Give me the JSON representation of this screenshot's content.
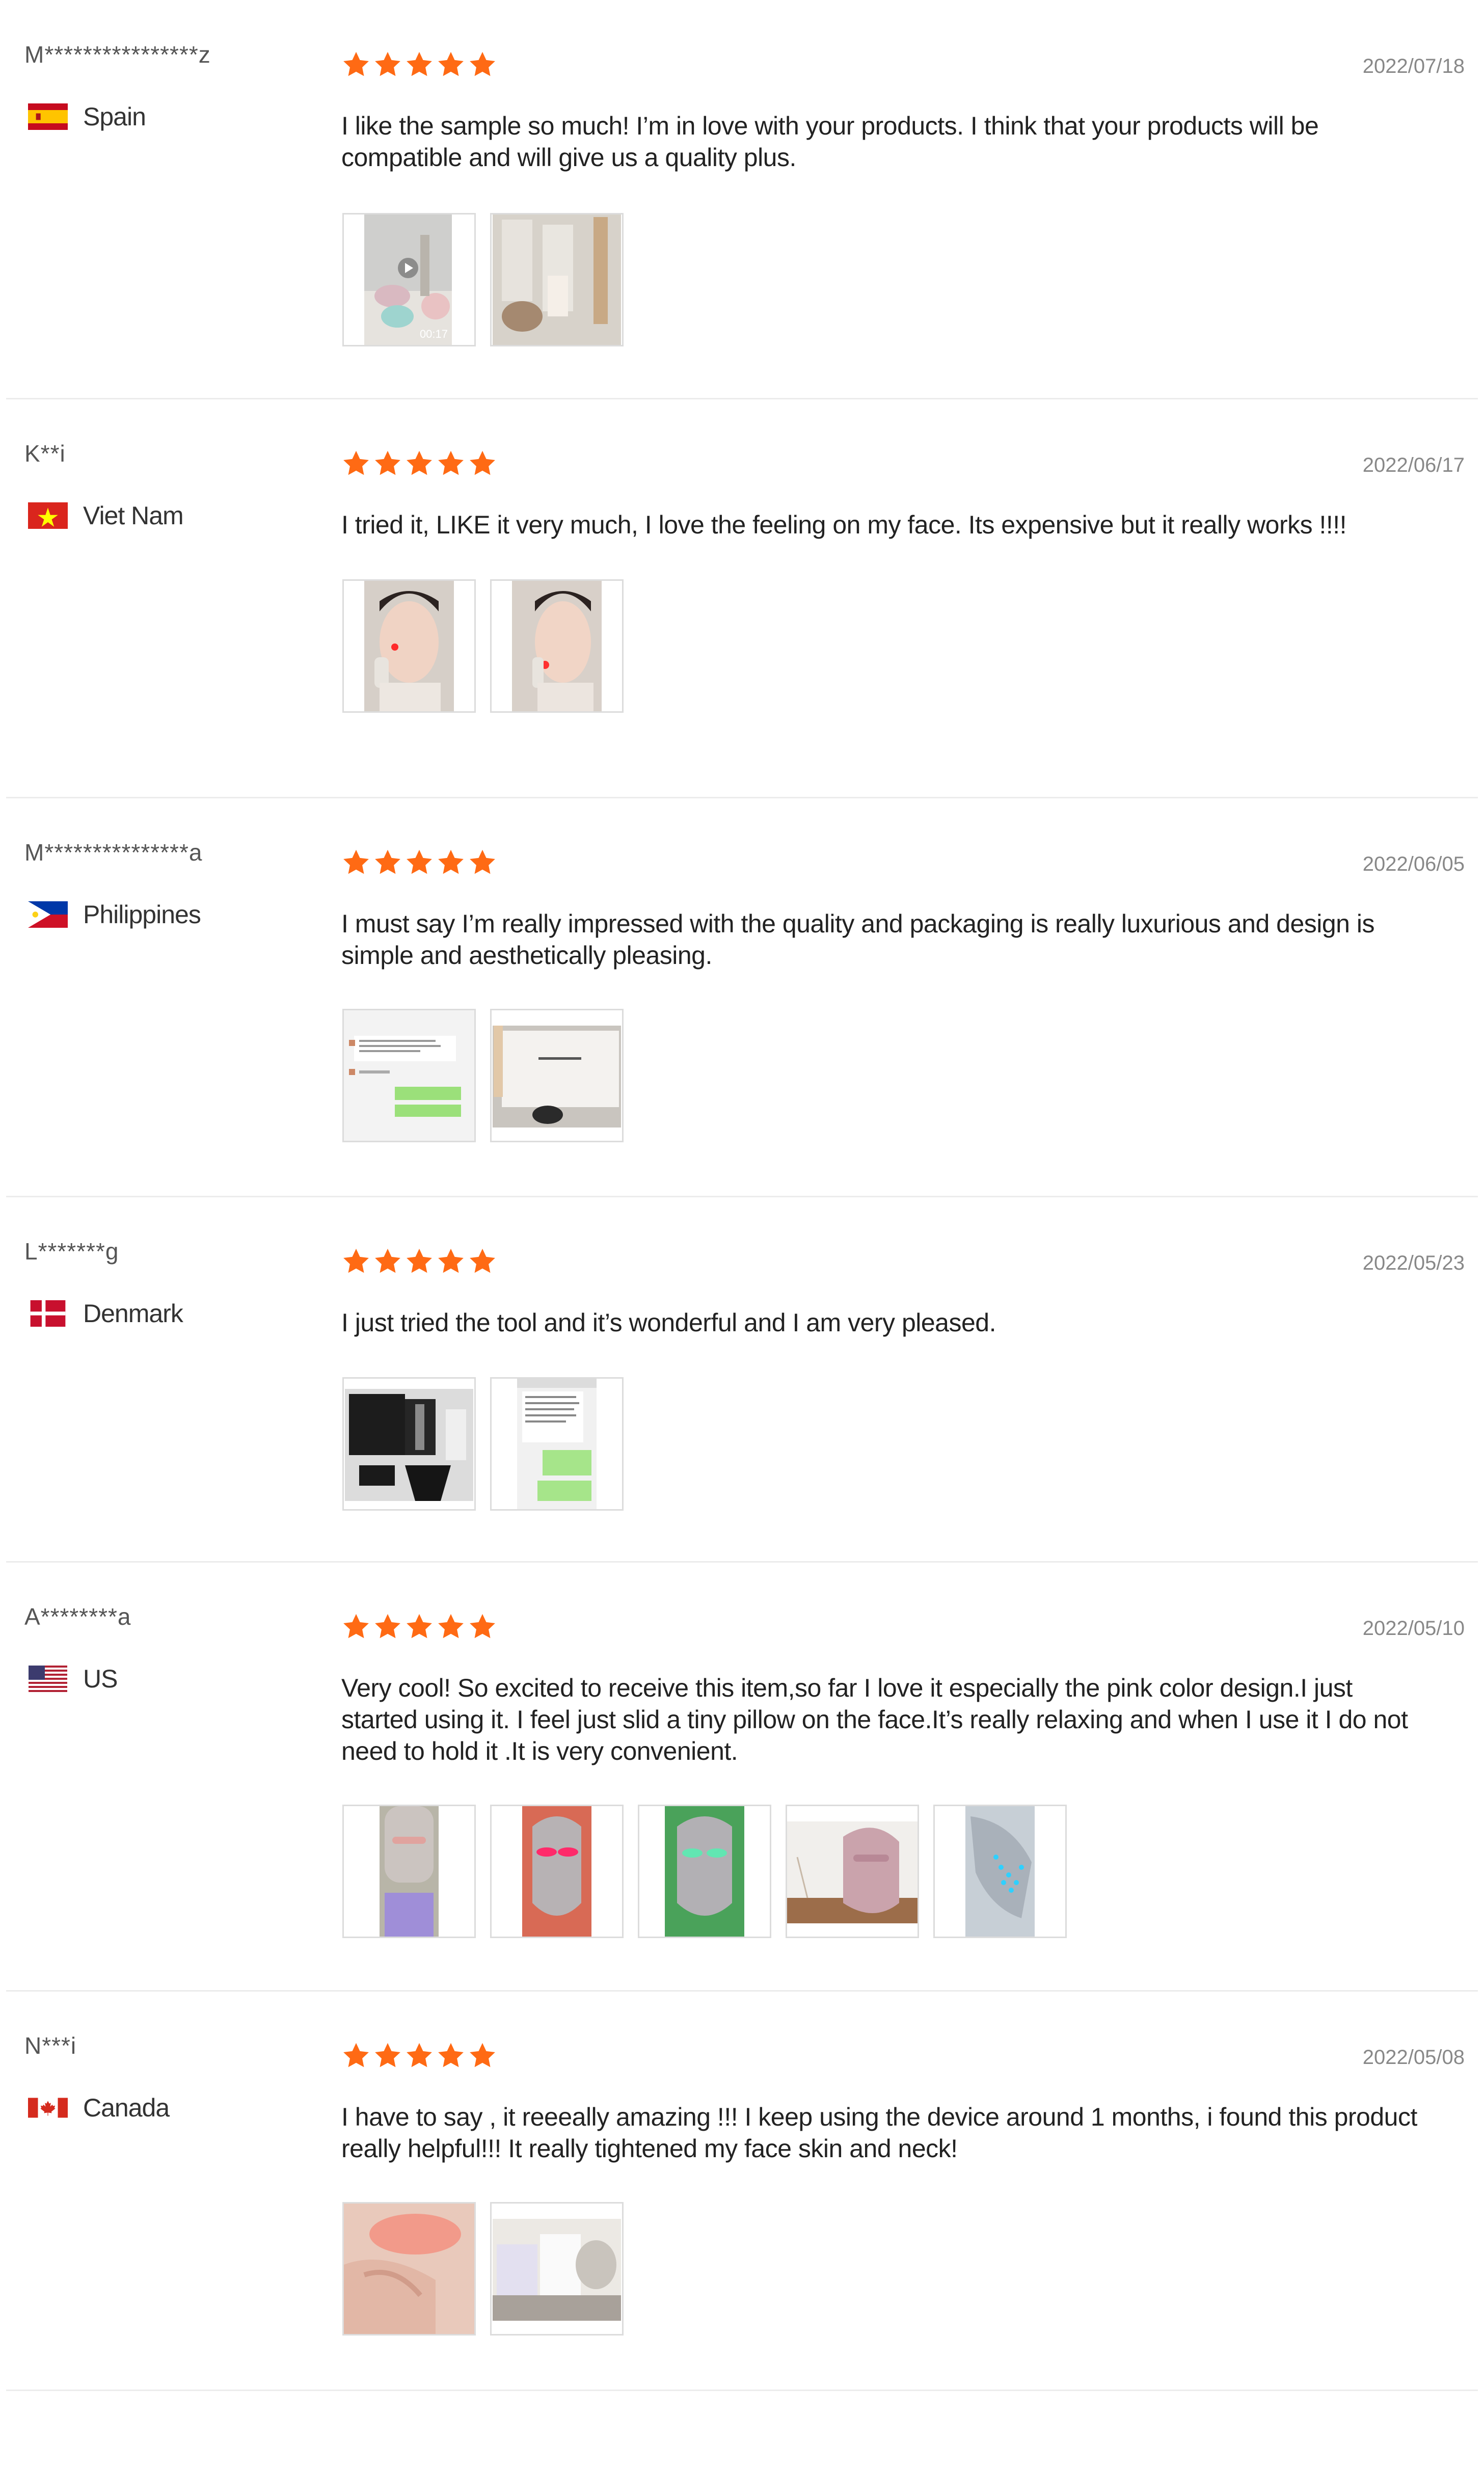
{
  "reviews": [
    {
      "user": "M****************z",
      "country": "Spain",
      "flag": "spain-flag-icon",
      "rating": 5,
      "date": "2022/07/18",
      "text": "I like the sample so much! I’m in love with your products. I think that your products will be compatible and will give us a quality plus.",
      "photos": [
        {
          "kind": "video",
          "name": "video-thumbnail-products",
          "duration": "00:17"
        },
        {
          "kind": "image",
          "name": "photo-products-packaging"
        }
      ]
    },
    {
      "user": "K**i",
      "country": "Viet Nam",
      "flag": "vietnam-flag-icon",
      "rating": 5,
      "date": "2022/06/17",
      "text": "I tried it, LIKE it very much, I love the feeling on my face. Its expensive but it really works !!!!",
      "photos": [
        {
          "kind": "image",
          "name": "photo-face-device-1"
        },
        {
          "kind": "image",
          "name": "photo-face-device-2"
        }
      ]
    },
    {
      "user": "M***************a",
      "country": "Philippines",
      "flag": "philippines-flag-icon",
      "rating": 5,
      "date": "2022/06/05",
      "text": "I must say I’m really impressed with the quality and packaging is really luxurious and design is simple and aesthetically pleasing.",
      "photos": [
        {
          "kind": "image",
          "name": "photo-chat-screenshot"
        },
        {
          "kind": "image",
          "name": "photo-beauty-partner-box"
        }
      ]
    },
    {
      "user": "L*******g",
      "country": "Denmark",
      "flag": "denmark-flag-icon",
      "rating": 5,
      "date": "2022/05/23",
      "text": "I just tried the tool and it’s wonderful and I am very pleased.",
      "photos": [
        {
          "kind": "image",
          "name": "photo-device-kit"
        },
        {
          "kind": "image",
          "name": "photo-chat-messages"
        }
      ]
    },
    {
      "user": "A********a",
      "country": "US",
      "flag": "us-flag-icon",
      "rating": 5,
      "date": "2022/05/10",
      "text": "Very cool! So excited to receive this item,so far I love it especially the pink color design.I just started using it. I feel just slid a tiny pillow on the face.It’s really relaxing  and when I use it I do not need to hold it .It is very convenient.",
      "photos": [
        {
          "kind": "image",
          "name": "photo-mask-worn"
        },
        {
          "kind": "image",
          "name": "photo-mask-red-light"
        },
        {
          "kind": "image",
          "name": "photo-mask-green-light"
        },
        {
          "kind": "image",
          "name": "photo-mask-pink"
        },
        {
          "kind": "image",
          "name": "photo-mask-blue-light"
        }
      ]
    },
    {
      "user": "N***i",
      "country": "Canada",
      "flag": "canada-flag-icon",
      "rating": 5,
      "date": "2022/05/08",
      "text": "I have to say , it reeeally amazing !!! I keep using the device around 1 months, i found this product really helpful!!! It really tightened my face skin and neck!",
      "photos": [
        {
          "kind": "image",
          "name": "photo-neck-red-light"
        },
        {
          "kind": "image",
          "name": "photo-device-box"
        }
      ]
    }
  ],
  "colors": {
    "star": "#ff6a14",
    "divider": "#ececec",
    "date": "#888888"
  }
}
